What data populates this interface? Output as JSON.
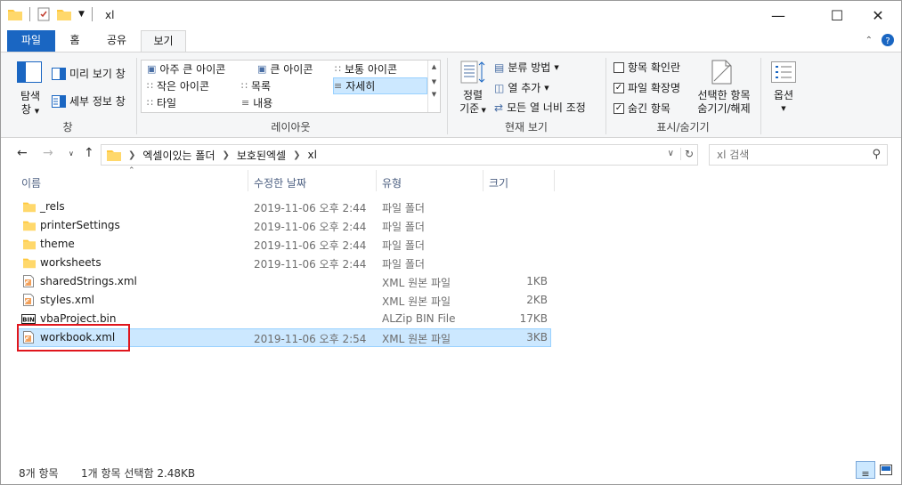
{
  "window": {
    "title": "xl",
    "controls": [
      "minimize",
      "maximize",
      "close"
    ]
  },
  "tabs": [
    {
      "label": "파일",
      "active": false
    },
    {
      "label": "홈",
      "active": false
    },
    {
      "label": "공유",
      "active": false
    },
    {
      "label": "보기",
      "active": true
    }
  ],
  "ribbon": {
    "panes": {
      "nav_pane": "탐색\n창",
      "nav_pane_line1": "탐색",
      "nav_pane_line2": "창",
      "preview": "미리 보기 창",
      "details": "세부 정보 창",
      "label": "창"
    },
    "layout": {
      "items": [
        "아주 큰 아이콘",
        "큰 아이콘",
        "보통 아이콘",
        "작은 아이콘",
        "목록",
        "자세히",
        "타일",
        "내용"
      ],
      "selected": "자세히",
      "label": "레이아웃"
    },
    "current_view": {
      "sort_line1": "정렬",
      "sort_line2": "기준",
      "group_by": "분류 방법",
      "add_columns": "열 추가",
      "fit_columns": "모든 열 너비 조정",
      "label": "현재 보기"
    },
    "show_hide": {
      "checkboxes": [
        {
          "label": "항목 확인란",
          "checked": false
        },
        {
          "label": "파일 확장명",
          "checked": true
        },
        {
          "label": "숨긴 항목",
          "checked": true
        }
      ],
      "hide_selected_line1": "선택한 항목",
      "hide_selected_line2": "숨기기/해제",
      "label": "표시/숨기기"
    },
    "options": "옵션"
  },
  "address": {
    "crumbs": [
      "엑셀이있는 폴더",
      "보호된엑셀",
      "xl"
    ],
    "search_placeholder": "xl 검색"
  },
  "columns": {
    "name": "이름",
    "modified": "수정한 날짜",
    "type": "유형",
    "size": "크기"
  },
  "files": [
    {
      "name": "_rels",
      "modified": "2019-11-06 오후 2:44",
      "type": "파일 폴더",
      "size": "",
      "icon": "folder-icon",
      "selected": false
    },
    {
      "name": "printerSettings",
      "modified": "2019-11-06 오후 2:44",
      "type": "파일 폴더",
      "size": "",
      "icon": "folder-icon",
      "selected": false
    },
    {
      "name": "theme",
      "modified": "2019-11-06 오후 2:44",
      "type": "파일 폴더",
      "size": "",
      "icon": "folder-icon",
      "selected": false
    },
    {
      "name": "worksheets",
      "modified": "2019-11-06 오후 2:44",
      "type": "파일 폴더",
      "size": "",
      "icon": "folder-icon",
      "selected": false
    },
    {
      "name": "sharedStrings.xml",
      "modified": "",
      "type": "XML 원본 파일",
      "size": "1KB",
      "icon": "xml-file-icon",
      "selected": false
    },
    {
      "name": "styles.xml",
      "modified": "",
      "type": "XML 원본 파일",
      "size": "2KB",
      "icon": "xml-file-icon",
      "selected": false
    },
    {
      "name": "vbaProject.bin",
      "modified": "",
      "type": "ALZip BIN File",
      "size": "17KB",
      "icon": "bin-file-icon",
      "selected": false
    },
    {
      "name": "workbook.xml",
      "modified": "2019-11-06 오후 2:54",
      "type": "XML 원본 파일",
      "size": "3KB",
      "icon": "xml-file-icon",
      "selected": true
    }
  ],
  "status": {
    "count": "8개 항목",
    "selection": "1개 항목 선택함 2.48KB"
  },
  "colors": {
    "accent": "#1a66c2",
    "selection": "#cce8ff",
    "highlight_box": "#e0161d",
    "folder": "#ffc83d"
  }
}
